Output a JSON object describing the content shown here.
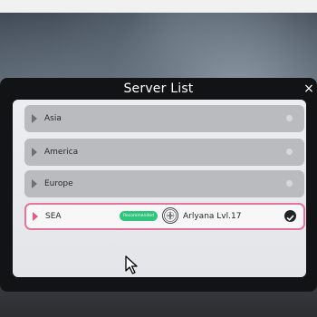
{
  "dialog": {
    "title": "Server List",
    "close_glyph": "×"
  },
  "servers": [
    {
      "name": "Asia",
      "selected": false
    },
    {
      "name": "America",
      "selected": false
    },
    {
      "name": "Europe",
      "selected": false
    },
    {
      "name": "SEA",
      "selected": true,
      "badge": "Recommended",
      "player": "Arlyana  Lvl.17"
    }
  ],
  "icons": {
    "row_marker": "play-triangle-icon",
    "status": "status-dot-icon",
    "selected": "checkmark-circle-icon",
    "avatar": "compass-avatar-icon",
    "cursor": "mouse-pointer-icon"
  },
  "colors": {
    "accent_pink": "#e3749b",
    "badge_green": "#30c47d",
    "row_gray": "#b9bbbf",
    "dialog_bg": "#121315"
  }
}
